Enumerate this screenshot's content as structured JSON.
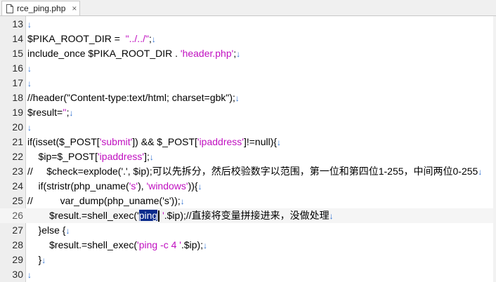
{
  "tab": {
    "label": "rce_ping.php",
    "close": "×",
    "icon": "file-icon"
  },
  "eol_marker": "↓",
  "lines": [
    {
      "n": "13",
      "segs": []
    },
    {
      "n": "14",
      "segs": [
        {
          "t": "$PIKA_ROOT_DIR =  "
        },
        {
          "t": "\"../../\"",
          "c": "str"
        },
        {
          "t": ";"
        }
      ]
    },
    {
      "n": "15",
      "segs": [
        {
          "t": "include_once $PIKA_ROOT_DIR . "
        },
        {
          "t": "'header.php'",
          "c": "str"
        },
        {
          "t": ";"
        }
      ]
    },
    {
      "n": "16",
      "segs": []
    },
    {
      "n": "17",
      "segs": []
    },
    {
      "n": "18",
      "segs": [
        {
          "t": "//header(\"Content-type:text/html; charset=gbk\");"
        }
      ]
    },
    {
      "n": "19",
      "segs": [
        {
          "t": "$result="
        },
        {
          "t": "''",
          "c": "str"
        },
        {
          "t": ";"
        }
      ]
    },
    {
      "n": "20",
      "segs": []
    },
    {
      "n": "21",
      "segs": [
        {
          "t": "if(isset($_POST["
        },
        {
          "t": "'submit'",
          "c": "str"
        },
        {
          "t": "]) && $_POST["
        },
        {
          "t": "'ipaddress'",
          "c": "str"
        },
        {
          "t": "]!=null){"
        }
      ]
    },
    {
      "n": "22",
      "segs": [
        {
          "t": "    $ip=$_POST["
        },
        {
          "t": "'ipaddress'",
          "c": "str"
        },
        {
          "t": "];"
        }
      ]
    },
    {
      "n": "23",
      "segs": [
        {
          "t": "//     $check=explode('.', $ip);可以先拆分，然后校验数字以范围，第一位和第四位1-255，中间两位0-255"
        }
      ]
    },
    {
      "n": "24",
      "segs": [
        {
          "t": "    if(stristr(php_uname("
        },
        {
          "t": "'s'",
          "c": "str"
        },
        {
          "t": "), "
        },
        {
          "t": "'windows'",
          "c": "str"
        },
        {
          "t": ")){"
        }
      ]
    },
    {
      "n": "25",
      "segs": [
        {
          "t": "//          var_dump(php_uname('s'));"
        }
      ]
    },
    {
      "n": "26",
      "current": true,
      "segs": [
        {
          "t": "        $result.=shell_exec("
        },
        {
          "t": "'"
        },
        {
          "t": "ping",
          "c": "sel"
        },
        {
          "t": "",
          "c": "caret"
        },
        {
          "t": " '",
          "c": "str"
        },
        {
          "t": ".$ip);//直接将变量拼接进来，没做处理"
        }
      ]
    },
    {
      "n": "27",
      "segs": [
        {
          "t": "    }else {"
        }
      ]
    },
    {
      "n": "28",
      "segs": [
        {
          "t": "        $result.=shell_exec("
        },
        {
          "t": "'ping -c 4 '",
          "c": "str"
        },
        {
          "t": ".$ip);"
        }
      ]
    },
    {
      "n": "29",
      "segs": [
        {
          "t": "    }"
        }
      ]
    },
    {
      "n": "30",
      "segs": []
    }
  ]
}
